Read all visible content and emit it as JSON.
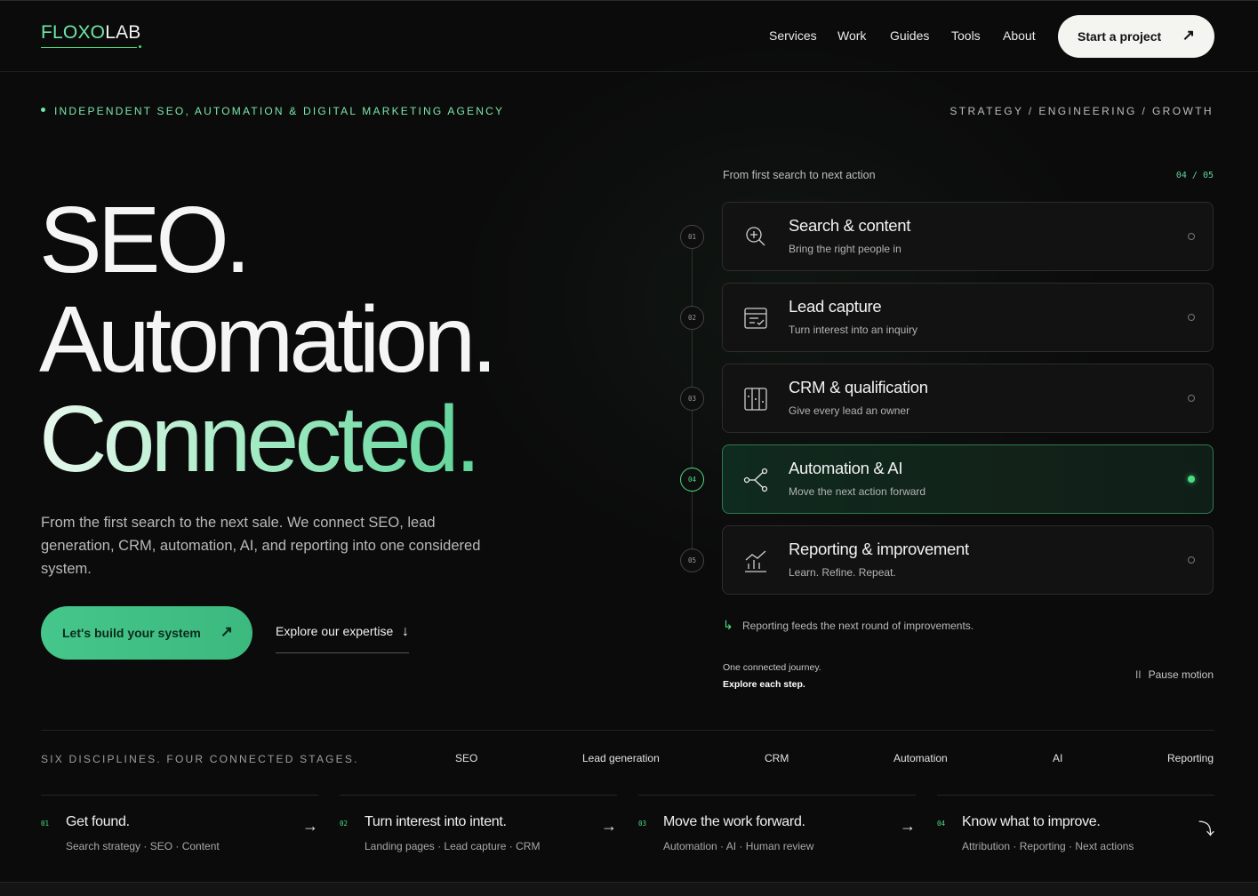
{
  "brand": {
    "logo_a": "FLOXO",
    "logo_b": "LAB",
    "accent": "#4ade80"
  },
  "nav": [
    "Services",
    "Work",
    "Guides",
    "Tools",
    "About"
  ],
  "header_cta": {
    "label": "Start a project",
    "icon": "arrow-up-right-icon"
  },
  "eyebrow": {
    "left": "INDEPENDENT SEO, AUTOMATION & DIGITAL MARKETING AGENCY",
    "right": "STRATEGY / ENGINEERING / GROWTH"
  },
  "hero": {
    "line1": "SEO.",
    "line2": "Automation.",
    "line3": "Connected.",
    "lead": "From the first search to the next sale. We connect SEO, lead generation, CRM, automation, AI, and reporting into one considered system.",
    "primary_cta": "Let's build your system",
    "secondary_cta": "Explore our expertise"
  },
  "journey": {
    "title": "From first search to next action",
    "counter": "04 / 05",
    "active_index": 3,
    "steps": [
      {
        "num": "01",
        "title": "Search & content",
        "subtitle": "Bring the right people in",
        "icon": "search-plus-icon"
      },
      {
        "num": "02",
        "title": "Lead capture",
        "subtitle": "Turn interest into an inquiry",
        "icon": "form-check-icon"
      },
      {
        "num": "03",
        "title": "CRM & qualification",
        "subtitle": "Give every lead an owner",
        "icon": "columns-icon"
      },
      {
        "num": "04",
        "title": "Automation & AI",
        "subtitle": "Move the next action forward",
        "icon": "branch-nodes-icon"
      },
      {
        "num": "05",
        "title": "Reporting & improvement",
        "subtitle": "Learn. Refine. Repeat.",
        "icon": "chart-trend-icon"
      }
    ],
    "feedback": "Reporting feeds the next round of improvements.",
    "note1": "One connected journey.",
    "note2": "Explore each step.",
    "pause": "Pause motion"
  },
  "disciplines": {
    "title": "SIX DISCIPLINES. FOUR CONNECTED STAGES.",
    "items": [
      "SEO",
      "Lead generation",
      "CRM",
      "Automation",
      "AI",
      "Reporting"
    ]
  },
  "stages": [
    {
      "num": "01",
      "title": "Get found.",
      "subtitle": "Search strategy · SEO · Content",
      "arrow": "→"
    },
    {
      "num": "02",
      "title": "Turn interest into intent.",
      "subtitle": "Landing pages · Lead capture · CRM",
      "arrow": "→"
    },
    {
      "num": "03",
      "title": "Move the work forward.",
      "subtitle": "Automation · AI · Human review",
      "arrow": "→"
    },
    {
      "num": "04",
      "title": "Know what to improve.",
      "subtitle": "Attribution · Reporting · Next actions",
      "arrow": "⤵"
    }
  ]
}
